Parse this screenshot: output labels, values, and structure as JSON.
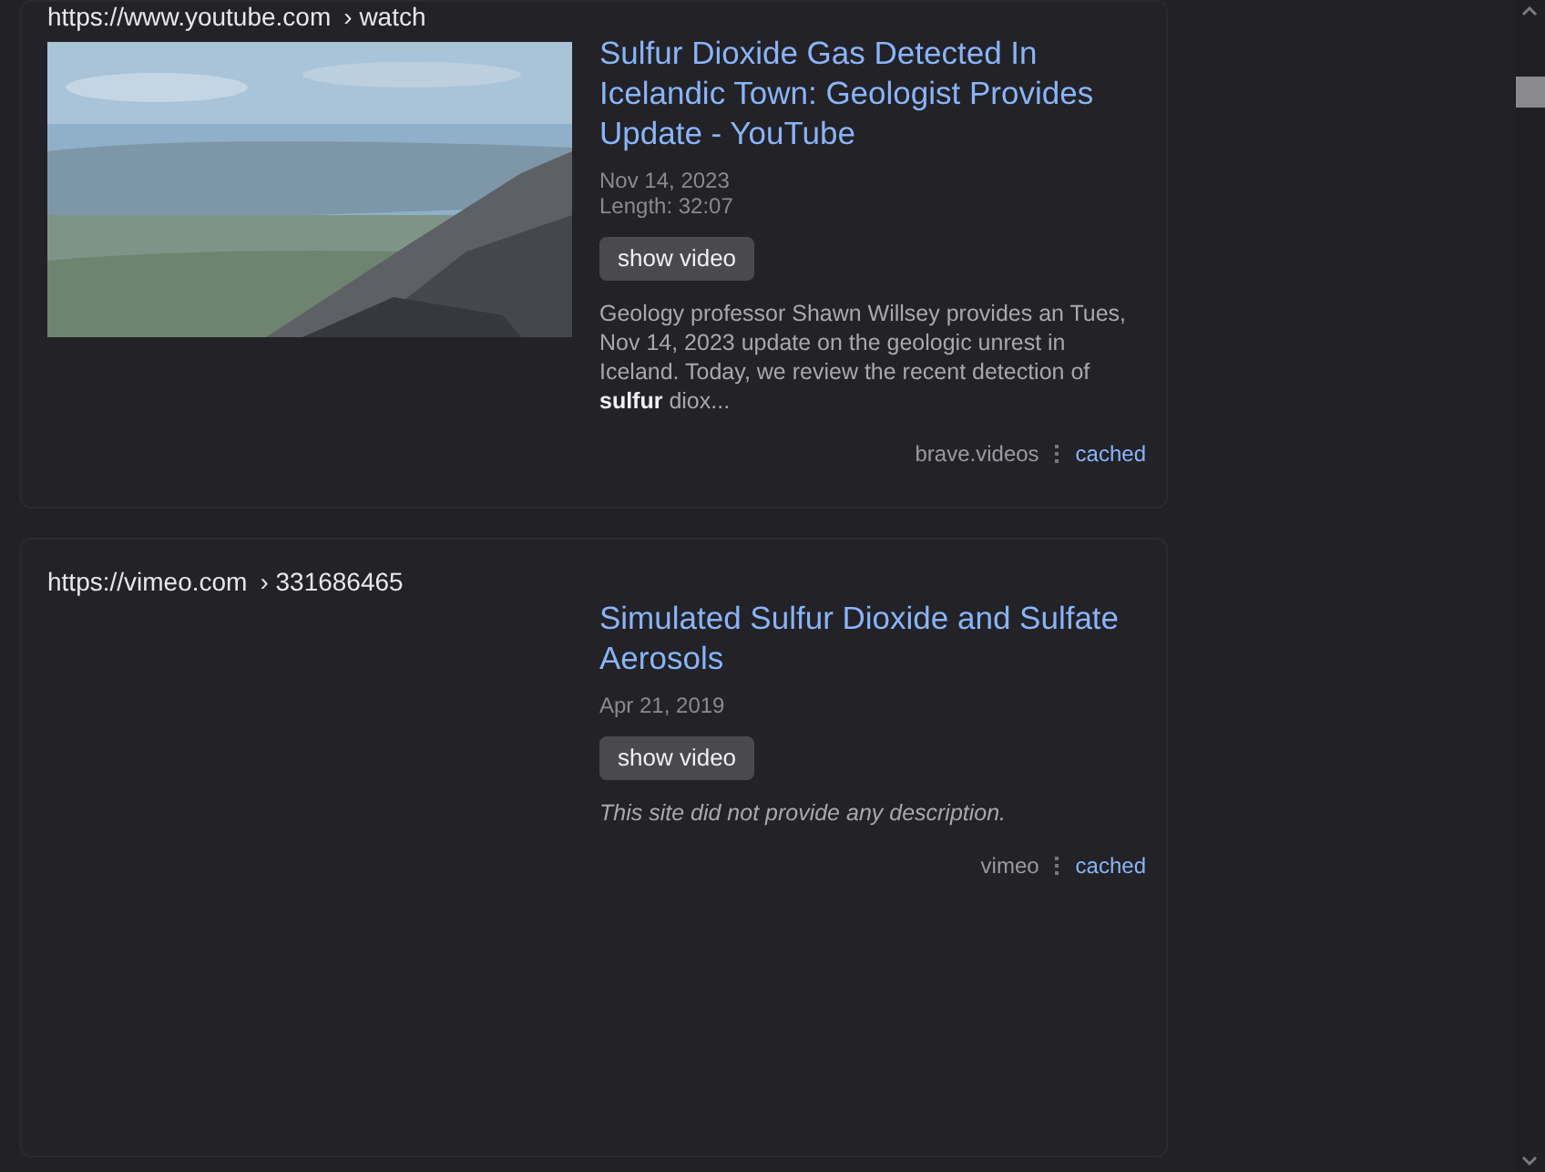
{
  "results": [
    {
      "url": "https://www.youtube.com",
      "path": "› watch",
      "title": "Sulfur Dioxide Gas Detected In Icelandic Town: Geologist Provides Update - YouTube",
      "meta": [
        "Nov 14, 2023",
        "Length: 32:07"
      ],
      "button": "show video",
      "description": {
        "kind": "text",
        "text": "Geology professor Shawn Willsey provides an Tues, Nov 14, 2023 update on the geologic unrest in Iceland. Today, we review the recent detection of **sulfur** diox..."
      },
      "source": "brave.videos",
      "cached": "cached"
    },
    {
      "url": "https://vimeo.com",
      "path": "› 331686465",
      "title": "Simulated Sulfur Dioxide and Sulfate Aerosols",
      "meta": [
        "Apr 21, 2019"
      ],
      "button": "show video",
      "description": {
        "kind": "missing",
        "text": "This site did not provide any description."
      },
      "source": "vimeo",
      "cached": "cached"
    }
  ]
}
